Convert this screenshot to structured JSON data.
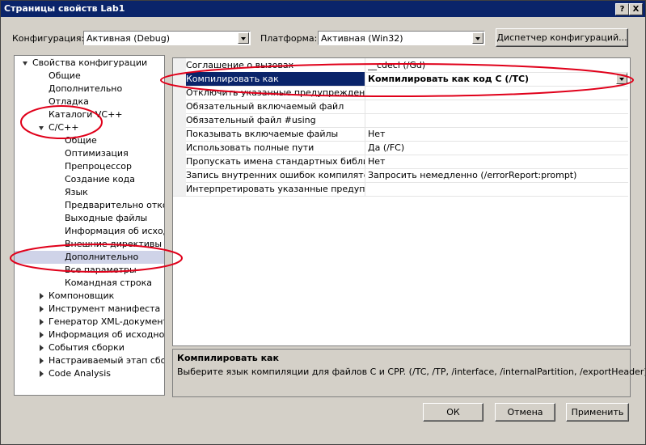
{
  "window": {
    "title": "Страницы свойств Lab1",
    "help_label": "?",
    "close_label": "X"
  },
  "toolbar": {
    "config_label": "Конфигурация:",
    "config_value": "Активная (Debug)",
    "platform_label": "Платформа:",
    "platform_value": "Активная (Win32)",
    "config_manager_label": "Диспетчер конфигураций..."
  },
  "tree": {
    "root": "Свойства конфигурации",
    "items": [
      "Общие",
      "Дополнительно",
      "Отладка",
      "Каталоги VC++"
    ],
    "cpp": {
      "label": "C/C++",
      "children": [
        "Общие",
        "Оптимизация",
        "Препроцессор",
        "Создание кода",
        "Язык",
        "Предварительно откомпилированные заголовки",
        "Выходные файлы",
        "Информация об исходном файле",
        "Внешние директивы include",
        "Дополнительно",
        "Все параметры",
        "Командная строка"
      ]
    },
    "collapsed": [
      "Компоновщик",
      "Инструмент манифеста",
      "Генератор XML-документов",
      "Информация об исходном коде",
      "События сборки",
      "Настраиваемый этап сборки",
      "Code Analysis"
    ]
  },
  "grid": {
    "rows": [
      {
        "name": "Соглашение о вызовах",
        "value": "__cdecl (/Gd)"
      },
      {
        "name": "Компилировать как",
        "value": "Компилировать как код C (/TC)",
        "selected": true
      },
      {
        "name": "Отключить указанные предупреждения",
        "value": ""
      },
      {
        "name": "Обязательный включаемый файл",
        "value": ""
      },
      {
        "name": "Обязательный файл #using",
        "value": ""
      },
      {
        "name": "Показывать включаемые файлы",
        "value": "Нет"
      },
      {
        "name": "Использовать полные пути",
        "value": "Да (/FC)"
      },
      {
        "name": "Пропускать имена стандартных библиотек",
        "value": "Нет"
      },
      {
        "name": "Запись внутренних ошибок компилятора",
        "value": "Запросить немедленно (/errorReport:prompt)"
      },
      {
        "name": "Интерпретировать указанные предупреждения как ошибки",
        "value": ""
      }
    ]
  },
  "description": {
    "title": "Компилировать как",
    "text": "Выберите язык компиляции для файлов C и CPP.    (/TC, /TP, /interface, /internalPartition, /exportHeader)"
  },
  "buttons": {
    "ok": "ОК",
    "cancel": "Отмена",
    "apply": "Применить"
  },
  "colors": {
    "annotation": "#e0001a",
    "selection": "#0a246a",
    "tree_selection": "#cfd3e8"
  }
}
